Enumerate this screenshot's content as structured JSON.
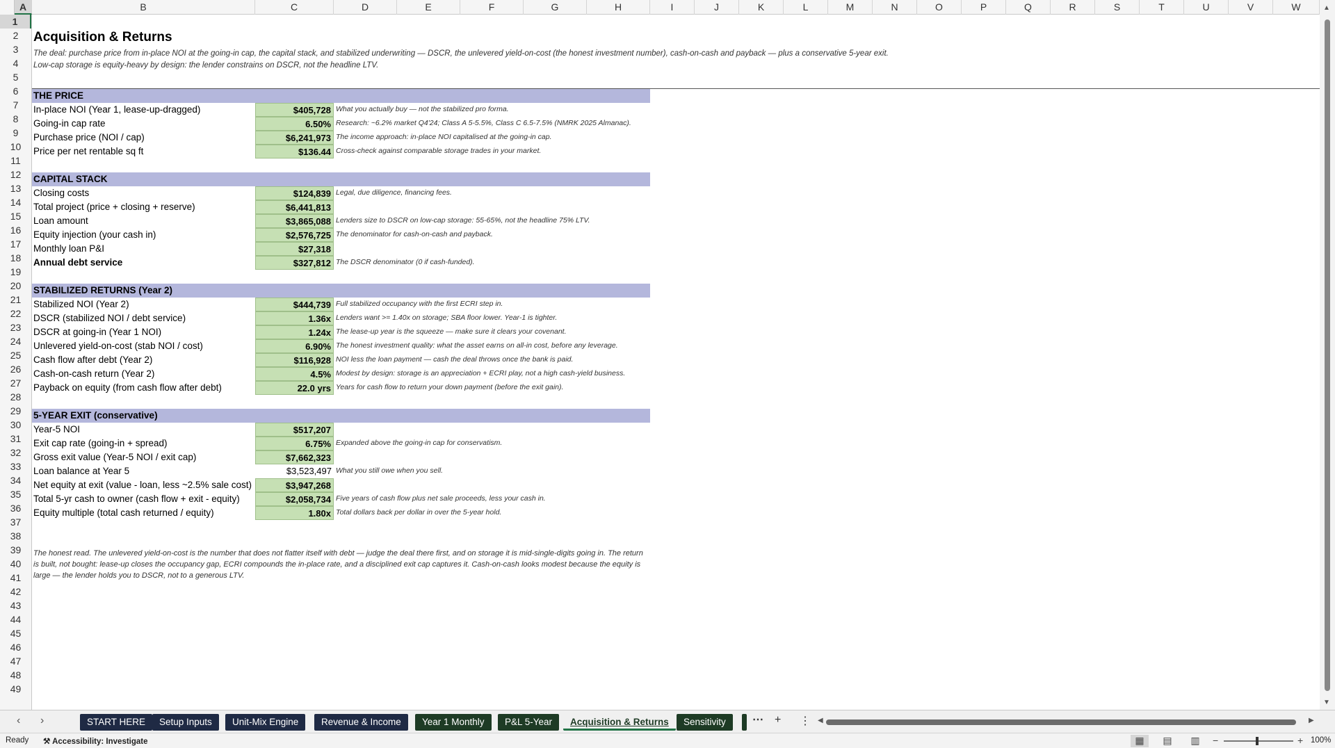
{
  "columns": [
    "A",
    "B",
    "C",
    "D",
    "E",
    "F",
    "G",
    "H",
    "I",
    "J",
    "K",
    "L",
    "M",
    "N",
    "O",
    "P",
    "Q",
    "R",
    "S",
    "T",
    "U",
    "V",
    "W"
  ],
  "rows": [
    "1",
    "2",
    "3",
    "4",
    "5",
    "6",
    "7",
    "8",
    "9",
    "10",
    "11",
    "12",
    "13",
    "14",
    "15",
    "16",
    "17",
    "18",
    "19",
    "20",
    "21",
    "22",
    "23",
    "24",
    "25",
    "26",
    "27",
    "28",
    "29",
    "30",
    "31",
    "32",
    "33",
    "34",
    "35",
    "36",
    "37",
    "38",
    "39",
    "40",
    "41",
    "42",
    "43",
    "44",
    "45",
    "46",
    "47",
    "48",
    "49"
  ],
  "sheet": {
    "title": "Acquisition & Returns",
    "subtitle1": "The deal: purchase price from in-place NOI at the going-in cap, the capital stack, and stabilized underwriting — DSCR, the unlevered yield-on-cost (the honest investment number), cash-on-cash and payback — plus a conservative 5-year exit.",
    "subtitle2": "Low-cap storage is equity-heavy by design: the lender constrains on DSCR, not the headline LTV.",
    "sections": {
      "price": "THE PRICE",
      "capital": "CAPITAL STACK",
      "stabilized": "STABILIZED RETURNS (Year 2)",
      "exit": "5-YEAR EXIT (conservative)"
    },
    "lines": [
      {
        "label": "In-place NOI (Year 1, lease-up-dragged)",
        "value": "$405,728",
        "note": "What you actually buy — not the stabilized pro forma."
      },
      {
        "label": "Going-in cap rate",
        "value": "6.50%",
        "note": "Research: ~6.2% market Q4'24; Class A 5-5.5%, Class C 6.5-7.5% (NMRK 2025 Almanac)."
      },
      {
        "label": "Purchase price (NOI / cap)",
        "value": "$6,241,973",
        "note": "The income approach: in-place NOI capitalised at the going-in cap."
      },
      {
        "label": "Price per net rentable sq ft",
        "value": "$136.44",
        "note": "Cross-check against comparable storage trades in your market."
      },
      {
        "label": "Closing costs",
        "value": "$124,839",
        "note": "Legal, due diligence, financing fees."
      },
      {
        "label": "Total project (price + closing + reserve)",
        "value": "$6,441,813",
        "note": ""
      },
      {
        "label": "Loan amount",
        "value": "$3,865,088",
        "note": "Lenders size to DSCR on low-cap storage: 55-65%, not the headline 75% LTV."
      },
      {
        "label": "Equity injection (your cash in)",
        "value": "$2,576,725",
        "note": "The denominator for cash-on-cash and payback."
      },
      {
        "label": "Monthly loan P&I",
        "value": "$27,318",
        "note": ""
      },
      {
        "label": "Annual debt service",
        "value": "$327,812",
        "note": "The DSCR denominator (0 if cash-funded)."
      },
      {
        "label": "Stabilized NOI (Year 2)",
        "value": "$444,739",
        "note": "Full stabilized occupancy with the first ECRI step in."
      },
      {
        "label": "DSCR (stabilized NOI / debt service)",
        "value": "1.36x",
        "note": "Lenders want >= 1.40x on storage; SBA floor lower. Year-1 is tighter."
      },
      {
        "label": "DSCR at going-in (Year 1 NOI)",
        "value": "1.24x",
        "note": "The lease-up year is the squeeze — make sure it clears your covenant."
      },
      {
        "label": "Unlevered yield-on-cost (stab NOI / cost)",
        "value": "6.90%",
        "note": "The honest investment quality: what the asset earns on all-in cost, before any leverage."
      },
      {
        "label": "Cash flow after debt (Year 2)",
        "value": "$116,928",
        "note": "NOI less the loan payment — cash the deal throws once the bank is paid."
      },
      {
        "label": "Cash-on-cash return (Year 2)",
        "value": "4.5%",
        "note": "Modest by design: storage is an appreciation + ECRI play, not a high cash-yield business."
      },
      {
        "label": "Payback on equity (from cash flow after debt)",
        "value": "22.0 yrs",
        "note": "Years for cash flow to return your down payment (before the exit gain)."
      },
      {
        "label": "Year-5 NOI",
        "value": "$517,207",
        "note": ""
      },
      {
        "label": "Exit cap rate (going-in + spread)",
        "value": "6.75%",
        "note": "Expanded above the going-in cap for conservatism."
      },
      {
        "label": "Gross exit value (Year-5 NOI / exit cap)",
        "value": "$7,662,323",
        "note": ""
      },
      {
        "label": "Loan balance at Year 5",
        "value": "$3,523,497",
        "note": "What you still owe when you sell."
      },
      {
        "label": "Net equity at exit (value - loan, less ~2.5% sale cost)",
        "value": "$3,947,268",
        "note": ""
      },
      {
        "label": "Total 5-yr cash to owner (cash flow + exit - equity)",
        "value": "$2,058,734",
        "note": "Five years of cash flow plus net sale proceeds, less your cash in."
      },
      {
        "label": "Equity multiple (total cash returned / equity)",
        "value": "1.80x",
        "note": "Total dollars back per dollar in over the 5-year hold."
      }
    ],
    "footer": "The honest read. The unlevered yield-on-cost is the number that does not flatter itself with debt — judge the deal there first, and on storage it is mid-single-digits going in. The return is built, not bought: lease-up closes the occupancy gap, ECRI compounds the in-place rate, and a disciplined exit cap captures it. Cash-on-cash looks modest because the equity is large — the lender holds you to DSCR, not to a generous LTV."
  },
  "tabs": [
    "START HERE",
    "Setup Inputs",
    "Unit-Mix Engine",
    "Revenue & Income",
    "Year 1 Monthly",
    "P&L 5-Year",
    "Acquisition & Returns",
    "Sensitivity"
  ],
  "status": {
    "ready": "Ready",
    "accessibility": "Accessibility: Investigate",
    "zoom": "100%"
  },
  "colors": {
    "section_fill": "#b4b7dc",
    "value_fill": "#c6e0b4",
    "tab_navy": "#1f2a44",
    "tab_green": "#1e3b25",
    "accent": "#217346"
  }
}
